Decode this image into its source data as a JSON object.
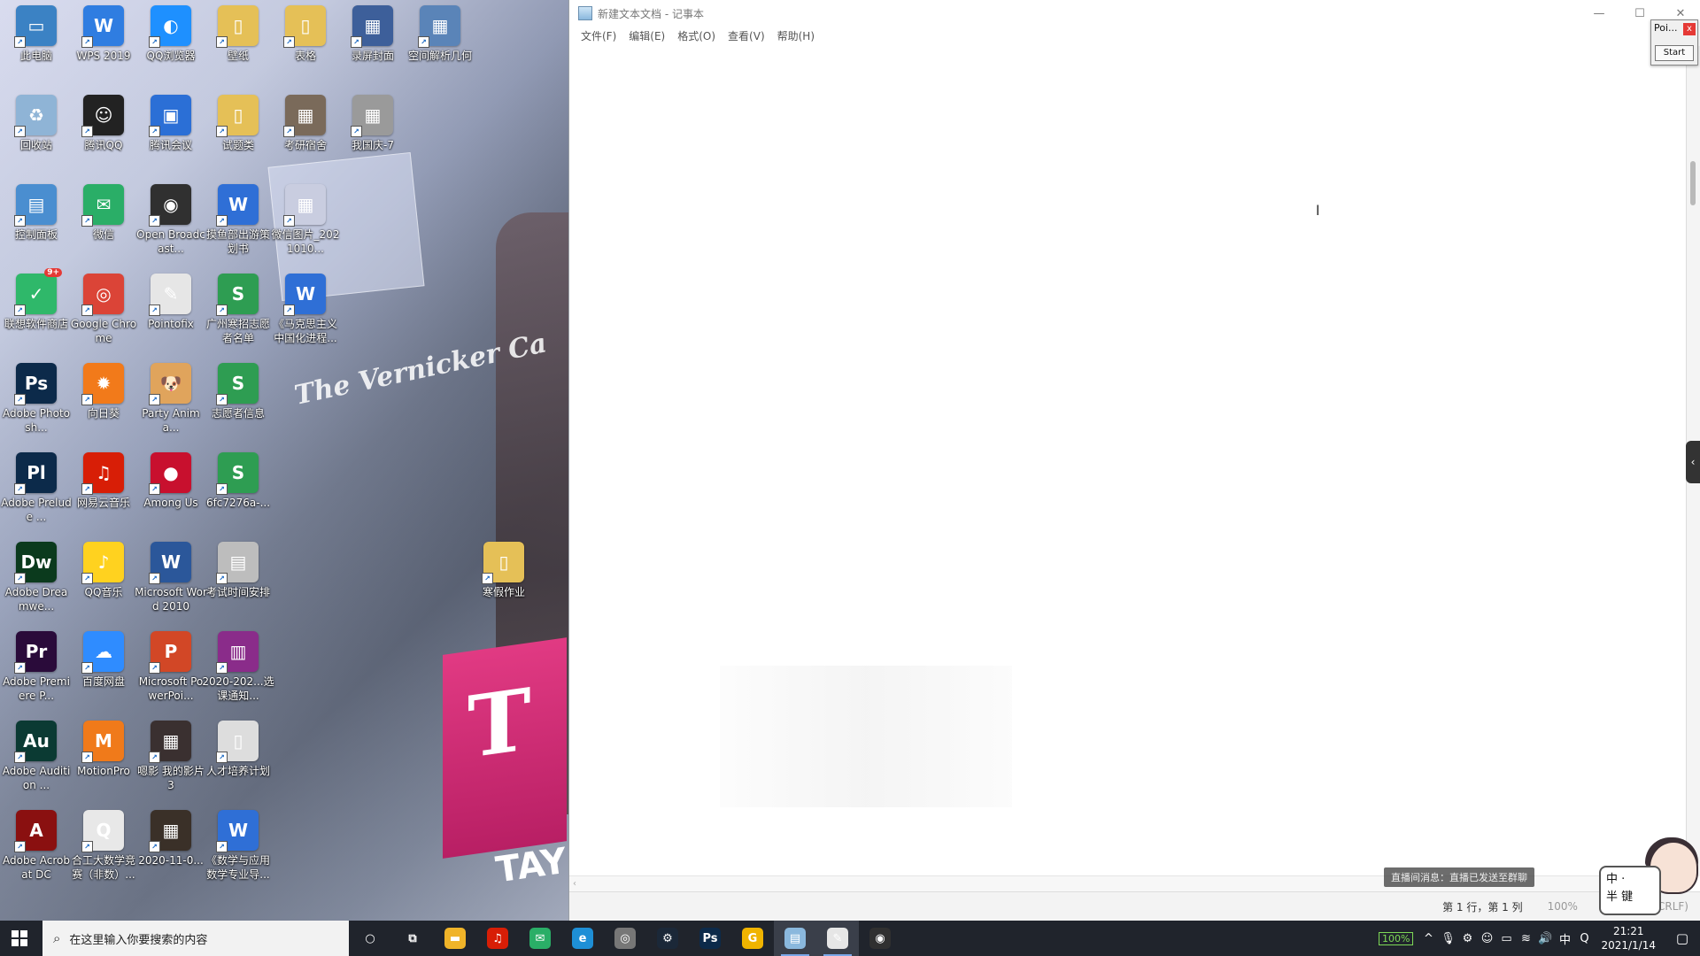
{
  "desktop": {
    "wallpaper_text": "The Vernicker Ca",
    "wallpaper_tay": "TAY",
    "wallpaper_t": "T",
    "icons": [
      {
        "label": "此电脑",
        "color": "#3b82c4",
        "glyph": "▭",
        "icon": "computer-icon"
      },
      {
        "label": "WPS 2019",
        "color": "#2f7de1",
        "glyph": "W",
        "icon": "wps-icon"
      },
      {
        "label": "QQ浏览器",
        "color": "#1e90ff",
        "glyph": "◐",
        "icon": "qq-browser-icon"
      },
      {
        "label": "壁纸",
        "color": "#e5c057",
        "glyph": "▯",
        "icon": "folder-icon"
      },
      {
        "label": "表格",
        "color": "#e5c057",
        "glyph": "▯",
        "icon": "folder-icon"
      },
      {
        "label": "录屏封面",
        "color": "#3d5f9a",
        "glyph": "▦",
        "icon": "image-icon"
      },
      {
        "label": "空间解析几何",
        "color": "#5a84b8",
        "glyph": "▦",
        "icon": "image-icon"
      },
      {
        "label": "回收站",
        "color": "#8fb4d6",
        "glyph": "♻",
        "icon": "recycle-bin-icon"
      },
      {
        "label": "腾讯QQ",
        "color": "#222222",
        "glyph": "☺",
        "icon": "qq-icon"
      },
      {
        "label": "腾讯会议",
        "color": "#2b6fd6",
        "glyph": "▣",
        "icon": "tencent-meeting-icon"
      },
      {
        "label": "试题类",
        "color": "#e5c057",
        "glyph": "▯",
        "icon": "folder-icon"
      },
      {
        "label": "考研宿舍",
        "color": "#7a6a5a",
        "glyph": "▦",
        "icon": "image-icon"
      },
      {
        "label": "我国庆-7",
        "color": "#9a9a9a",
        "glyph": "▦",
        "icon": "image-icon"
      },
      {
        "label": "控制面板",
        "color": "#4a8ed0",
        "glyph": "▤",
        "icon": "control-panel-icon"
      },
      {
        "label": "微信",
        "color": "#2aae67",
        "glyph": "✉",
        "icon": "wechat-icon"
      },
      {
        "label": "Open Broadcast...",
        "color": "#303030",
        "glyph": "◉",
        "icon": "obs-icon"
      },
      {
        "label": "摸鱼部出游策划书",
        "color": "#2f6fd6",
        "glyph": "W",
        "icon": "word-doc-icon"
      },
      {
        "label": "微信图片_2021010...",
        "color": "#c9cde0",
        "glyph": "▦",
        "icon": "image-icon"
      },
      {
        "label": "联想软件商店",
        "color": "#2fb86a",
        "glyph": "✓",
        "icon": "lenovo-store-icon",
        "badge": "9+"
      },
      {
        "label": "Google Chrome",
        "color": "#db4437",
        "glyph": "◎",
        "icon": "chrome-icon"
      },
      {
        "label": "Pointofix",
        "color": "#e6e6e6",
        "glyph": "✎",
        "icon": "pointofix-icon"
      },
      {
        "label": "广州寒招志愿者名单",
        "color": "#2e9d52",
        "glyph": "S",
        "icon": "sheet-icon"
      },
      {
        "label": "《马克思主义中国化进程...",
        "color": "#2f6fd6",
        "glyph": "W",
        "icon": "word-doc-icon"
      },
      {
        "label": "Adobe Photosh...",
        "color": "#0c2a4a",
        "glyph": "Ps",
        "icon": "photoshop-icon"
      },
      {
        "label": "向日葵",
        "color": "#f27a1a",
        "glyph": "✹",
        "icon": "sunflower-icon"
      },
      {
        "label": "Party Anima...",
        "color": "#e0a45c",
        "glyph": "🐶",
        "icon": "party-animals-icon"
      },
      {
        "label": "志愿者信息",
        "color": "#2e9d52",
        "glyph": "S",
        "icon": "sheet-icon"
      },
      {
        "label": "Adobe Prelude ...",
        "color": "#0c2a4a",
        "glyph": "Pl",
        "icon": "prelude-icon"
      },
      {
        "label": "网易云音乐",
        "color": "#d81e06",
        "glyph": "♫",
        "icon": "netease-music-icon"
      },
      {
        "label": "Among Us",
        "color": "#c8102e",
        "glyph": "●",
        "icon": "among-us-icon"
      },
      {
        "label": "6fc7276a-...",
        "color": "#2e9d52",
        "glyph": "S",
        "icon": "sheet-icon"
      },
      {
        "label": "Adobe Dreamwe...",
        "color": "#0b3a1d",
        "glyph": "Dw",
        "icon": "dreamweaver-icon"
      },
      {
        "label": "QQ音乐",
        "color": "#ffd21f",
        "glyph": "♪",
        "icon": "qq-music-icon"
      },
      {
        "label": "Microsoft Word 2010",
        "color": "#2b579a",
        "glyph": "W",
        "icon": "word-icon"
      },
      {
        "label": "考试时间安排",
        "color": "#bdbdbd",
        "glyph": "▤",
        "icon": "image-icon"
      },
      {
        "label": "寒假作业",
        "color": "#e5c057",
        "glyph": "▯",
        "icon": "folder-icon"
      },
      {
        "label": "Adobe Premiere P...",
        "color": "#2a0b3a",
        "glyph": "Pr",
        "icon": "premiere-icon"
      },
      {
        "label": "百度网盘",
        "color": "#2f8cff",
        "glyph": "☁",
        "icon": "baidu-pan-icon"
      },
      {
        "label": "Microsoft PowerPoi...",
        "color": "#d24726",
        "glyph": "P",
        "icon": "powerpoint-icon"
      },
      {
        "label": "2020-202...选课通知...",
        "color": "#8a2c8a",
        "glyph": "▥",
        "icon": "winrar-icon"
      },
      {
        "label": "Adobe Audition ...",
        "color": "#0b3a33",
        "glyph": "Au",
        "icon": "audition-icon"
      },
      {
        "label": "MotionPro",
        "color": "#f07a1a",
        "glyph": "M",
        "icon": "motionpro-icon"
      },
      {
        "label": "嗯影 我的影片3",
        "color": "#3a3030",
        "glyph": "▦",
        "icon": "video-icon"
      },
      {
        "label": "人才培养计划",
        "color": "#dddddd",
        "glyph": "▯",
        "icon": "document-icon"
      },
      {
        "label": "Adobe Acrobat DC",
        "color": "#8a1010",
        "glyph": "A",
        "icon": "acrobat-icon"
      },
      {
        "label": "合工大数学竞赛（非数）...",
        "color": "#e8e8e8",
        "glyph": "Q",
        "icon": "pdf-icon"
      },
      {
        "label": "2020-11-0...",
        "color": "#3a3028",
        "glyph": "▦",
        "icon": "video-icon"
      },
      {
        "label": "《数学与应用数学专业导...",
        "color": "#2f6fd6",
        "glyph": "W",
        "icon": "word-doc-icon"
      }
    ]
  },
  "notepad": {
    "title": "新建文本文档 - 记事本",
    "menu": [
      "文件(F)",
      "编辑(E)",
      "格式(O)",
      "查看(V)",
      "帮助(H)"
    ],
    "status": {
      "position": "第 1 行，第 1 列",
      "zoom": "100%",
      "encoding": "Windows (CRLF)"
    },
    "toast": "直播间消息：直播已发送至群聊"
  },
  "widgets": {
    "poi_title": "Poi...",
    "poi_close": "x",
    "poi_start": "Start",
    "ime_line1": "中 ·",
    "ime_line2": "半 键"
  },
  "taskbar": {
    "search_placeholder": "在这里输入你要搜索的内容",
    "apps": [
      {
        "name": "cortana",
        "glyph": "○",
        "color": "transparent"
      },
      {
        "name": "task-view",
        "glyph": "⧉",
        "color": "transparent"
      },
      {
        "name": "file-explorer",
        "glyph": "▬",
        "color": "#f0b429"
      },
      {
        "name": "netease-music",
        "glyph": "♫",
        "color": "#d81e06"
      },
      {
        "name": "wechat",
        "glyph": "✉",
        "color": "#2aae67"
      },
      {
        "name": "edge",
        "glyph": "e",
        "color": "#1e8fd6"
      },
      {
        "name": "overwatch",
        "glyph": "◎",
        "color": "#777777"
      },
      {
        "name": "steam",
        "glyph": "⚙",
        "color": "#1b2838"
      },
      {
        "name": "photoshop",
        "glyph": "Ps",
        "color": "#0c2a4a"
      },
      {
        "name": "g-app",
        "glyph": "G",
        "color": "#f0b400"
      },
      {
        "name": "notepad",
        "glyph": "▤",
        "color": "#8ab8dd",
        "active": true
      },
      {
        "name": "pointofix",
        "glyph": "✎",
        "color": "#e6e6e6",
        "active": true
      },
      {
        "name": "obs",
        "glyph": "◉",
        "color": "#303030"
      }
    ],
    "battery": "100%",
    "time": "21:21",
    "date": "2021/1/14"
  }
}
